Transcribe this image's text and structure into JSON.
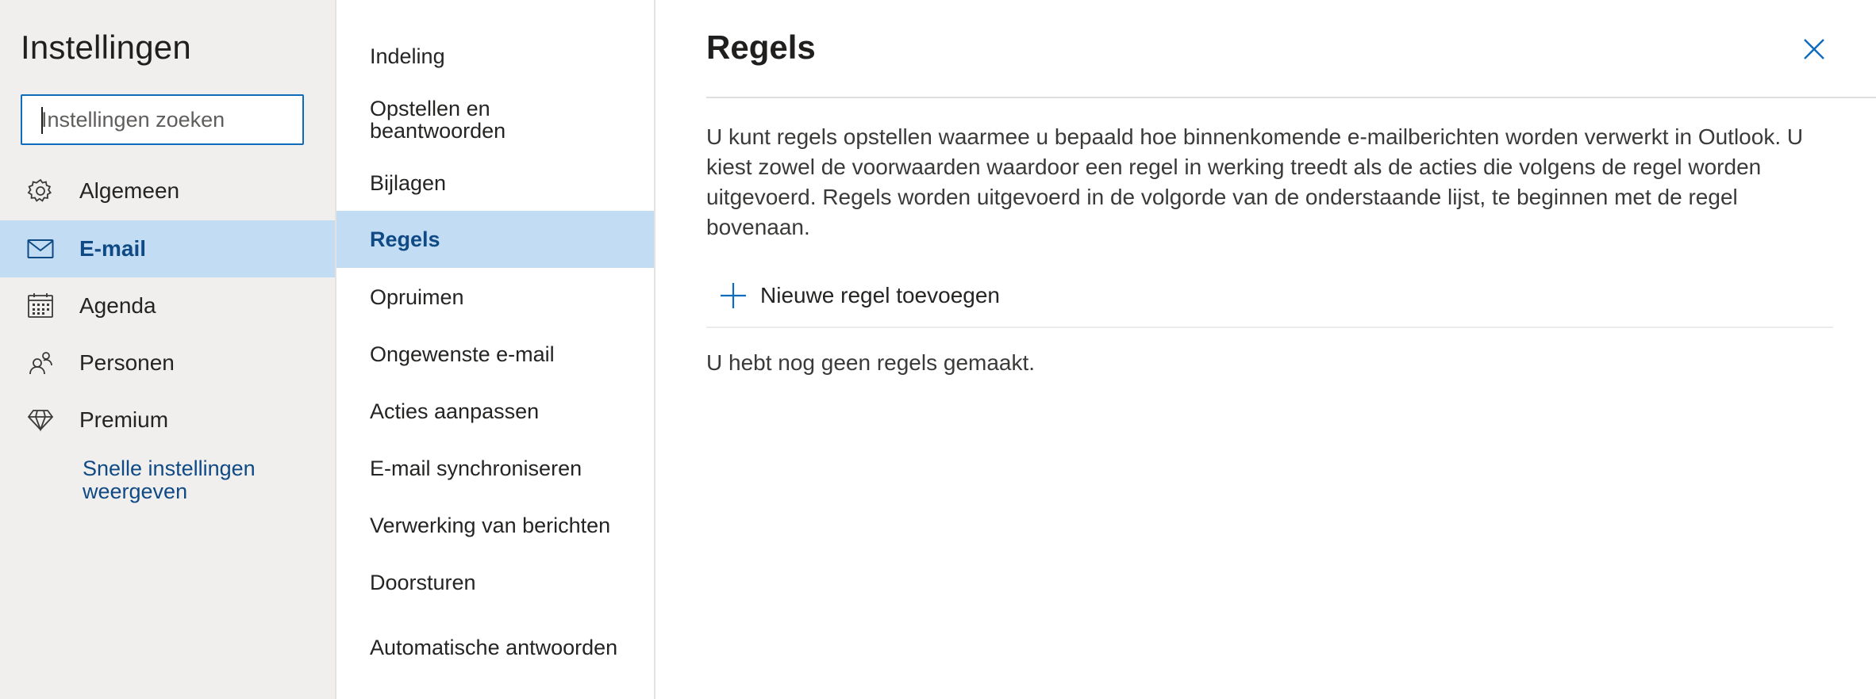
{
  "settings": {
    "title": "Instellingen",
    "search": {
      "placeholder": "Instellingen zoeken",
      "value": ""
    },
    "categories": [
      {
        "label": "Algemeen",
        "icon": "gear-icon",
        "active": false
      },
      {
        "label": "E-mail",
        "icon": "mail-icon",
        "active": true
      },
      {
        "label": "Agenda",
        "icon": "calendar-icon",
        "active": false
      },
      {
        "label": "Personen",
        "icon": "people-icon",
        "active": false
      },
      {
        "label": "Premium",
        "icon": "diamond-icon",
        "active": false
      }
    ],
    "quick_link": "Snelle instellingen weergeven"
  },
  "subnav": {
    "items": [
      {
        "label": "Indeling",
        "active": false
      },
      {
        "label": "Opstellen en beantwoorden",
        "active": false
      },
      {
        "label": "Bijlagen",
        "active": false
      },
      {
        "label": "Regels",
        "active": true
      },
      {
        "label": "Opruimen",
        "active": false
      },
      {
        "label": "Ongewenste e-mail",
        "active": false
      },
      {
        "label": "Acties aanpassen",
        "active": false
      },
      {
        "label": "E-mail synchroniseren",
        "active": false
      },
      {
        "label": "Verwerking van berichten",
        "active": false
      },
      {
        "label": "Doorsturen",
        "active": false
      },
      {
        "label": "Automatische antwoorden",
        "active": false
      }
    ]
  },
  "main": {
    "title": "Regels",
    "description": "U kunt regels opstellen waarmee u bepaald hoe binnenkomende e-mailberichten worden verwerkt in Outlook. U kiest zowel de voorwaarden waardoor een regel in werking treedt als de acties die volgens de regel worden uitgevoerd. Regels worden uitgevoerd in de volgorde van de onderstaande lijst, te beginnen met de regel bovenaan.",
    "add_rule_label": "Nieuwe regel toevoegen",
    "empty_message": "U hebt nog geen regels gemaakt."
  },
  "colors": {
    "accent": "#0f6cbd",
    "selected_bg": "#c2dcf3",
    "selected_text": "#0f4a85",
    "sidebar_bg": "#f0efee"
  }
}
